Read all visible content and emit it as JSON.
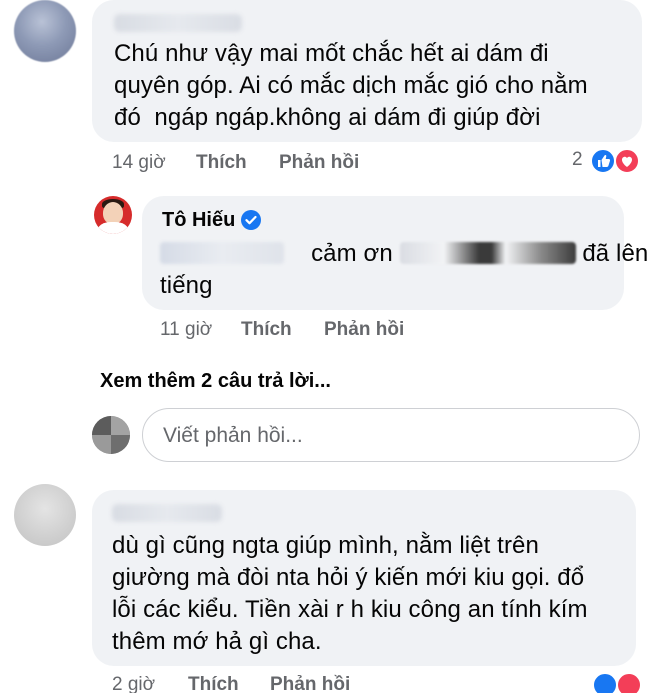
{
  "comments": [
    {
      "text_lines": [
        "Chú như vậy mai mốt chắc hết ai dám đi",
        "quyên góp. Ai có mắc dịch mắc gió cho nằm",
        "đó  ngáp ngáp.không ai dám đi giúp đời"
      ],
      "time": "14 giờ",
      "like_label": "Thích",
      "reply_label": "Phản hồi",
      "reaction_count": "2"
    },
    {
      "author": "Tô Hiếu",
      "text_line1": "cảm ơn",
      "text_line1_end": "đã lên",
      "text_line2": "tiếng",
      "time": "11 giờ",
      "like_label": "Thích",
      "reply_label": "Phản hồi"
    },
    {
      "text_lines": [
        "dù gì cũng ngta giúp mình, nằm liệt trên",
        "giường mà đòi nta hỏi ý kiến mới kiu gọi. đổ",
        "lỗi các kiểu. Tiền xài r h kiu công an tính kím",
        "thêm mớ hả gì cha."
      ],
      "time": "2 giờ",
      "like_label": "Thích",
      "reply_label": "Phản hồi"
    }
  ],
  "view_more_replies": "Xem thêm 2 câu trả lời...",
  "reply_input": {
    "placeholder": "Viết phản hồi..."
  },
  "colors": {
    "bubble": "#f0f2f5",
    "meta_text": "#65676b",
    "facebook_blue": "#1877f2",
    "love_red": "#f33e58"
  }
}
